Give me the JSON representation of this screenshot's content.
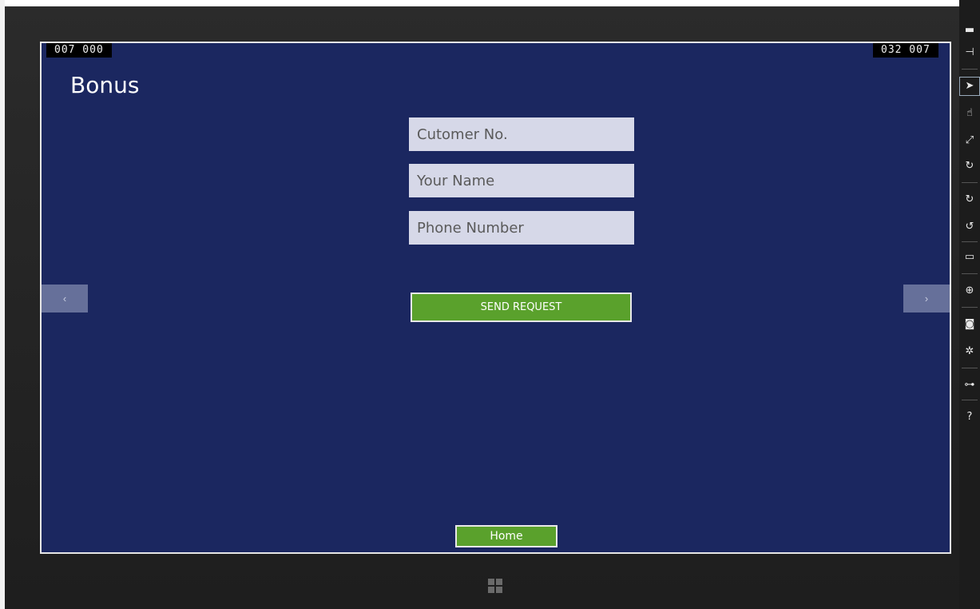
{
  "simulator": {
    "resolution_left": "007 000",
    "resolution_right": "032 007"
  },
  "page": {
    "title": "Bonus"
  },
  "form": {
    "customer_placeholder": "Cutomer No.",
    "name_placeholder": "Your Name",
    "phone_placeholder": "Phone Number",
    "send_label": "SEND REQUEST"
  },
  "nav": {
    "prev_label": "‹",
    "next_label": "›",
    "home_label": "Home"
  },
  "toolbar": {
    "items": [
      {
        "icon": "minimize-icon",
        "glyph": "▬"
      },
      {
        "icon": "pin-icon",
        "glyph": "⊣"
      },
      {
        "icon": "mouse-mode-icon",
        "glyph": "➤"
      },
      {
        "icon": "touch-mode-icon",
        "glyph": "☝"
      },
      {
        "icon": "pinch-zoom-icon",
        "glyph": "⤢"
      },
      {
        "icon": "rotation-touch-icon",
        "glyph": "↻"
      },
      {
        "icon": "rotate-clockwise-icon",
        "glyph": "↻"
      },
      {
        "icon": "rotate-counterclockwise-icon",
        "glyph": "↺"
      },
      {
        "icon": "change-resolution-icon",
        "glyph": "▭"
      },
      {
        "icon": "set-location-icon",
        "glyph": "⊕"
      },
      {
        "icon": "screenshot-icon",
        "glyph": "◙"
      },
      {
        "icon": "network-settings-icon",
        "glyph": "✲"
      },
      {
        "icon": "network-properties-icon",
        "glyph": "⊶"
      },
      {
        "icon": "help-icon",
        "glyph": "?"
      }
    ]
  },
  "colors": {
    "screen_background": "#1b2760",
    "accent_green": "#5aa12c",
    "field_background": "#d6d8e8"
  }
}
